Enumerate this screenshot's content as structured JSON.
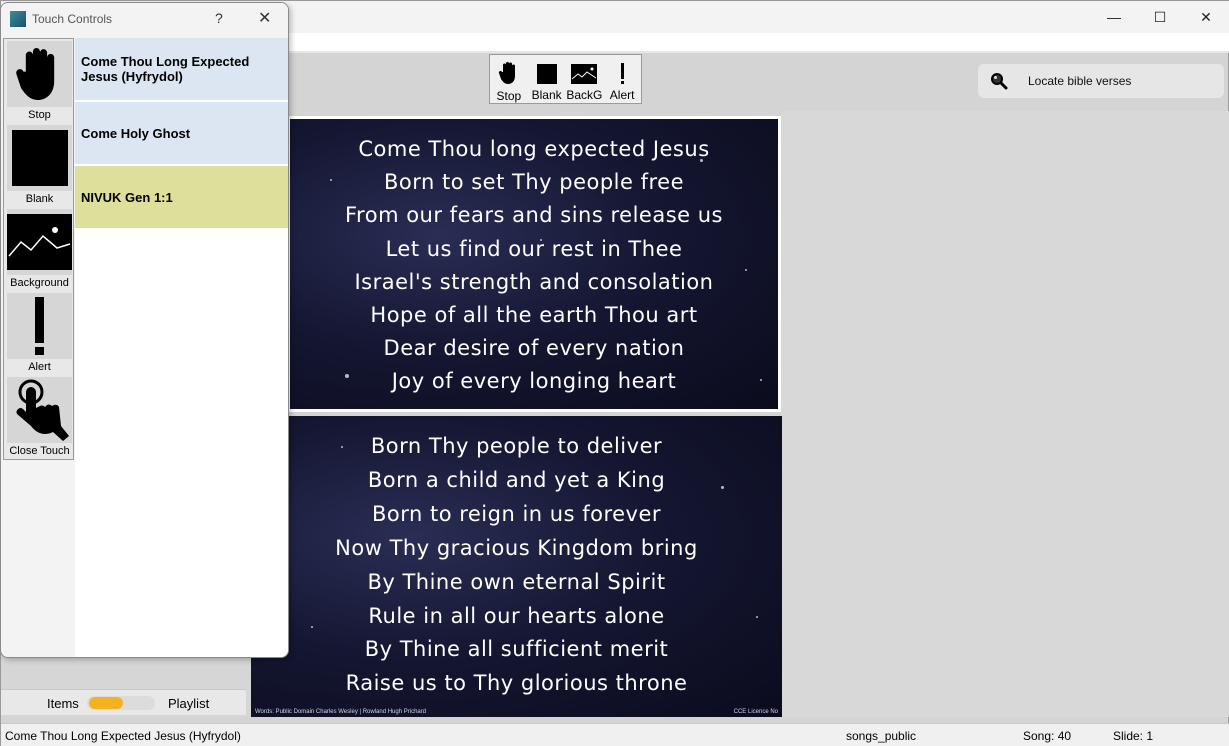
{
  "window": {
    "controls": {
      "minimize": "—",
      "maximize": "☐",
      "close": "✕"
    }
  },
  "toolbar": {
    "buttons": [
      {
        "label": "Stop",
        "icon": "hand-icon"
      },
      {
        "label": "Blank",
        "icon": "blank-icon"
      },
      {
        "label": "BackG",
        "icon": "background-icon"
      },
      {
        "label": "Alert",
        "icon": "alert-icon"
      }
    ]
  },
  "search": {
    "placeholder": "Locate bible verses"
  },
  "slides": [
    {
      "lines": [
        "Come Thou long expected Jesus",
        "Born to set Thy people free",
        "From our fears and sins release us",
        "Let us find our rest in Thee",
        "Israel's strength and consolation",
        "Hope of all the earth Thou art",
        "Dear desire of every nation",
        "Joy of every longing heart"
      ]
    },
    {
      "lines": [
        "Born Thy people to deliver",
        "Born a child and yet a King",
        "Born to reign in us forever",
        "Now Thy gracious Kingdom bring",
        "By Thine own eternal Spirit",
        "Rule in all our hearts alone",
        "By Thine all sufficient merit",
        "Raise us to Thy glorious throne"
      ],
      "credit_left": "Words: Public Domain  Charles Wesley | Rowland Hugh Prichard",
      "credit_right": "CCE Licence No"
    }
  ],
  "items_toggle": {
    "items": "Items",
    "playlist": "Playlist",
    "accent": "#f5b21f"
  },
  "status": {
    "song_title": "Come Thou Long Expected Jesus (Hyfrydol)",
    "database": "songs_public",
    "song": "Song: 40",
    "slide": "Slide: 1"
  },
  "touch": {
    "title": "Touch Controls",
    "help": "?",
    "close": "✕",
    "buttons": [
      {
        "label": "Stop",
        "icon": "hand-icon"
      },
      {
        "label": "Blank",
        "icon": "blank-icon"
      },
      {
        "label": "Background",
        "icon": "background-icon"
      },
      {
        "label": "Alert",
        "icon": "alert-icon"
      },
      {
        "label": "Close Touch",
        "icon": "touch-hand-icon"
      }
    ],
    "items": [
      {
        "label": "Come Thou Long Expected Jesus (Hyfrydol)",
        "color": "#dce6f2"
      },
      {
        "label": "Come Holy Ghost",
        "color": "#dce6f2"
      },
      {
        "label": "NIVUK Gen 1:1",
        "color": "#dfdf9c"
      }
    ]
  }
}
